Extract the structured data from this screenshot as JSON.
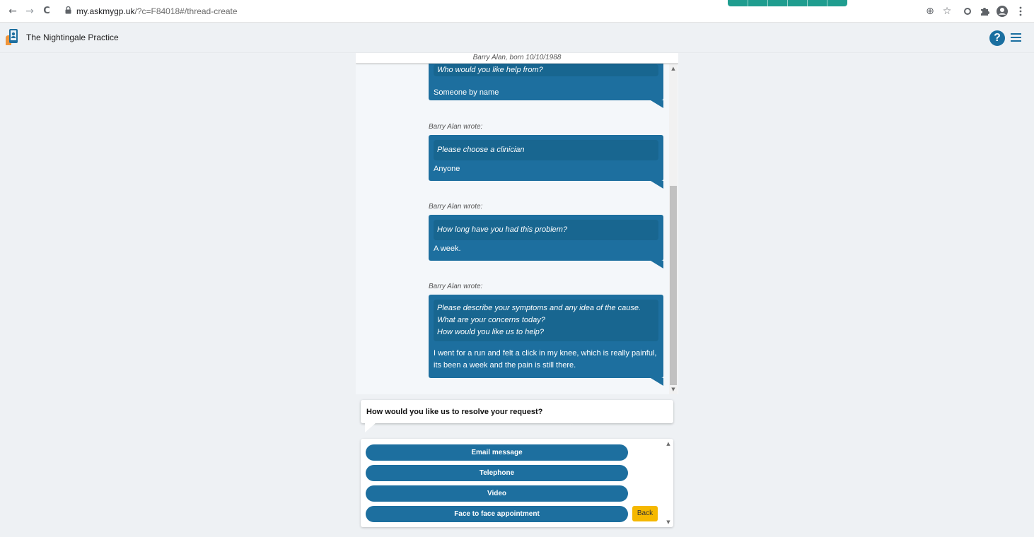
{
  "browser": {
    "back": "←",
    "forward": "→",
    "reload": "C",
    "url_host": "my.askmygp.uk",
    "url_path": "/?c=F84018#/thread-create",
    "icons": [
      "add-to-home-icon",
      "star-icon",
      "extension-circle-icon",
      "puzzle-icon",
      "profile-icon",
      "kebab-menu-icon"
    ]
  },
  "header": {
    "practice_name": "The Nightingale Practice",
    "help_label": "?"
  },
  "conversation": {
    "patient_banner": "Barry Alan, born 10/10/1988",
    "messages": [
      {
        "author": "",
        "question": "Who would you like help from?",
        "answer": "Someone by name"
      },
      {
        "author": "Barry Alan wrote:",
        "question": "Please choose a clinician",
        "answer": "Anyone"
      },
      {
        "author": "Barry Alan wrote:",
        "question": "How long have you had this problem?",
        "answer": "A week."
      },
      {
        "author": "Barry Alan wrote:",
        "question_lines": [
          "Please describe your symptoms and any idea of the cause.",
          "What are your concerns today?",
          "How would you like us to help?"
        ],
        "answer_lines": [
          "I went for a run and felt a click in my knee, which is really painful,",
          "its been a week and the pain is still there."
        ]
      }
    ]
  },
  "resolve": {
    "prompt": "How would you like us to resolve your request?",
    "options": [
      "Email message",
      "Telephone",
      "Video",
      "Face to face appointment"
    ],
    "back_label": "Back"
  },
  "colors": {
    "accent": "#1d6f9f",
    "question_bg": "#186690",
    "back_button": "#f5b800",
    "page_bg": "#eef1f4"
  }
}
